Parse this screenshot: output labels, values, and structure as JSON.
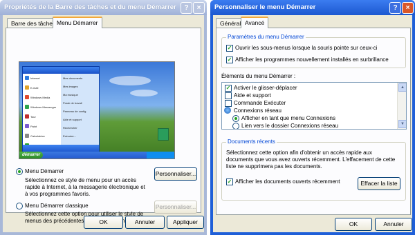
{
  "window1": {
    "title": "Propriétés de la Barre des tâches et du menu Démarrer",
    "tabs": [
      "Barre des tâches",
      "Menu Démarrer"
    ],
    "preview": {
      "start_label": "démarrer",
      "menu_left": [
        "Internet",
        "E-mail",
        "Windows Media",
        "Windows Messenger",
        "Tour",
        "Paint",
        "Calculatrice",
        "Tous les programmes"
      ],
      "menu_right": [
        "Mes documents",
        "Mes images",
        "Ma musique",
        "Poste de travail",
        "Panneau de config.",
        "Aide et support",
        "Rechercher",
        "Exécuter..."
      ]
    },
    "option_start": {
      "label": "Menu Démarrer",
      "desc": "Sélectionnez ce style de menu pour un accès rapide à Internet, à la messagerie électronique et à vos programmes favoris.",
      "button": "Personnaliser...",
      "selected": true
    },
    "option_classic": {
      "label": "Menu Démarrer classique",
      "desc": "Sélectionnez cette option pour utiliser le style de menus des précédentes versions de Windows.",
      "button": "Personnaliser...",
      "selected": false
    },
    "buttons": {
      "ok": "OK",
      "cancel": "Annuler",
      "apply": "Appliquer"
    },
    "title_buttons": {
      "help": "?",
      "close": "×"
    }
  },
  "window2": {
    "title": "Personnaliser le menu Démarrer",
    "tabs": [
      "Général",
      "Avancé"
    ],
    "group_settings": {
      "title": "Paramètres du menu Démarrer",
      "items": [
        {
          "label": "Ouvrir les sous-menus lorsque la souris pointe sur ceux-ci",
          "checked": true
        },
        {
          "label": "Afficher les programmes nouvellement installés en surbrillance",
          "checked": true
        }
      ]
    },
    "elements": {
      "title": "Éléments du menu Démarrer :",
      "items": [
        {
          "label": "Activer le glisser-déplacer",
          "kind": "checkbox",
          "checked": true
        },
        {
          "label": "Aide et support",
          "kind": "checkbox",
          "checked": false
        },
        {
          "label": "Commande Exécuter",
          "kind": "checkbox",
          "checked": false
        },
        {
          "label": "Connexions réseau",
          "kind": "header",
          "checked": false
        },
        {
          "label": "Afficher en tant que menu Connexions",
          "kind": "radio",
          "checked": true
        },
        {
          "label": "Lien vers le dossier Connexions réseau",
          "kind": "radio",
          "checked": false
        }
      ]
    },
    "group_recent": {
      "title": "Documents récents",
      "desc": "Sélectionnez cette option afin d'obtenir un accès rapide aux documents que vous avez ouverts récemment. L'effacement de cette liste ne supprimera pas les documents.",
      "checkbox": "Afficher les documents ouverts récemment",
      "checked": true,
      "clear_button": "Effacer la liste"
    },
    "buttons": {
      "ok": "OK",
      "cancel": "Annuler"
    },
    "title_buttons": {
      "help": "?",
      "close": "×"
    }
  }
}
